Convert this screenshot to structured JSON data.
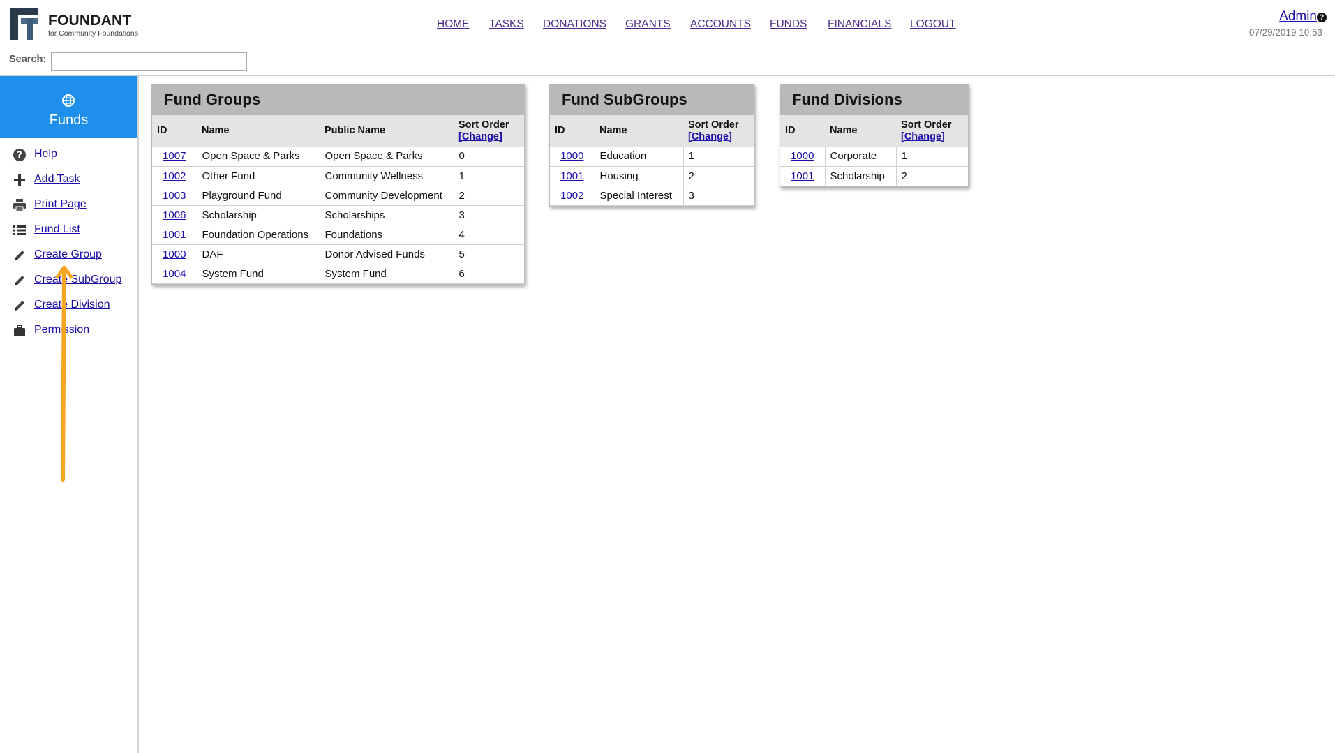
{
  "brand": {
    "name": "FOUNDANT",
    "tagline": "for Community Foundations"
  },
  "nav": [
    "HOME",
    "TASKS",
    "DONATIONS",
    "GRANTS",
    "ACCOUNTS",
    "FUNDS",
    "FINANCIALS",
    "LOGOUT"
  ],
  "user": {
    "name": "Admin",
    "datetime": "07/29/2019 10:53"
  },
  "search": {
    "label": "Search:",
    "value": ""
  },
  "sidebar": {
    "title": "Funds",
    "items": [
      {
        "label": "Help",
        "icon": "help-icon"
      },
      {
        "label": "Add Task",
        "icon": "plus-icon"
      },
      {
        "label": "Print Page",
        "icon": "print-icon"
      },
      {
        "label": "Fund List",
        "icon": "list-icon"
      },
      {
        "label": "Create Group",
        "icon": "pencil-icon"
      },
      {
        "label": "Create SubGroup",
        "icon": "pencil-icon"
      },
      {
        "label": "Create Division",
        "icon": "pencil-icon"
      },
      {
        "label": "Permission",
        "icon": "briefcase-icon"
      }
    ]
  },
  "fund_groups": {
    "title": "Fund Groups",
    "headers": {
      "id": "ID",
      "name": "Name",
      "public_name": "Public Name",
      "sort_order": "Sort Order",
      "change": "[Change]"
    },
    "rows": [
      {
        "id": "1007",
        "name": "Open Space & Parks",
        "public_name": "Open Space & Parks",
        "sort": "0"
      },
      {
        "id": "1002",
        "name": "Other Fund",
        "public_name": "Community Wellness",
        "sort": "1"
      },
      {
        "id": "1003",
        "name": "Playground Fund",
        "public_name": "Community Development",
        "sort": "2"
      },
      {
        "id": "1006",
        "name": "Scholarship",
        "public_name": "Scholarships",
        "sort": "3"
      },
      {
        "id": "1001",
        "name": "Foundation Operations",
        "public_name": "Foundations",
        "sort": "4"
      },
      {
        "id": "1000",
        "name": "DAF",
        "public_name": "Donor Advised Funds",
        "sort": "5"
      },
      {
        "id": "1004",
        "name": "System Fund",
        "public_name": "System Fund",
        "sort": "6"
      }
    ]
  },
  "fund_subgroups": {
    "title": "Fund SubGroups",
    "headers": {
      "id": "ID",
      "name": "Name",
      "sort_order": "Sort Order",
      "change": "[Change]"
    },
    "rows": [
      {
        "id": "1000",
        "name": "Education",
        "sort": "1"
      },
      {
        "id": "1001",
        "name": "Housing",
        "sort": "2"
      },
      {
        "id": "1002",
        "name": "Special Interest",
        "sort": "3"
      }
    ]
  },
  "fund_divisions": {
    "title": "Fund Divisions",
    "headers": {
      "id": "ID",
      "name": "Name",
      "sort_order": "Sort Order",
      "change": "[Change]"
    },
    "rows": [
      {
        "id": "1000",
        "name": "Corporate",
        "sort": "1"
      },
      {
        "id": "1001",
        "name": "Scholarship",
        "sort": "2"
      }
    ]
  },
  "colors": {
    "accent": "#1e90ec",
    "link": "#1a0dab",
    "nav_link": "#4b2a8a",
    "arrow": "#f5a623"
  }
}
